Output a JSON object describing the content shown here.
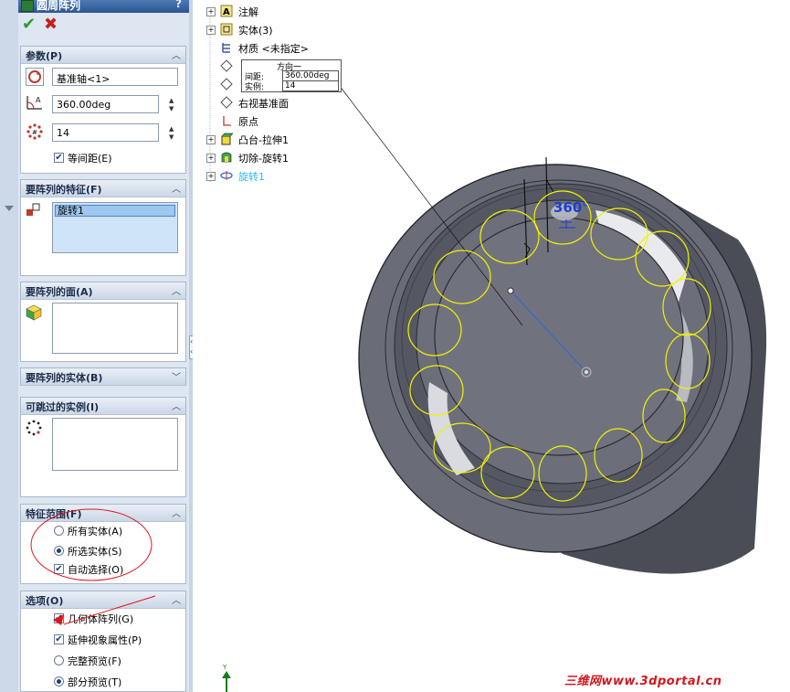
{
  "property_manager": {
    "title": "圆周阵列",
    "help": "?",
    "ok_icon": "checkmark-icon",
    "cancel_icon": "x-icon",
    "sections": {
      "params": {
        "label": "参数(P)",
        "axis_value": "基准轴<1>",
        "angle_value": "360.00deg",
        "instances_value": "14",
        "equal_spacing": "等间距(E)",
        "equal_spacing_checked": true
      },
      "features": {
        "label": "要阵列的特征(F)",
        "items": [
          "旋转1"
        ]
      },
      "faces": {
        "label": "要阵列的面(A)"
      },
      "bodies": {
        "label": "要阵列的实体(B)"
      },
      "skip": {
        "label": "可跳过的实例(I)"
      },
      "scope": {
        "label": "特征范围(F)",
        "all_bodies": "所有实体(A)",
        "selected_bodies": "所选实体(S)",
        "auto_select": "自动选择(O)",
        "selected": "selected_bodies",
        "auto_select_checked": true
      },
      "options": {
        "label": "选项(O)",
        "geometry_pattern": "几何体阵列(G)",
        "propagate": "延伸视象属性(P)",
        "full_preview": "完整预览(F)",
        "partial_preview": "部分预览(T)",
        "geometry_checked": true,
        "propagate_checked": true,
        "preview": "partial_preview"
      }
    }
  },
  "tree": {
    "items": [
      {
        "label": "注解",
        "icon": "annotation-icon",
        "expand": true
      },
      {
        "label": "实体(3)",
        "icon": "solid-bodies-icon",
        "expand": true
      },
      {
        "label": "材质 <未指定>",
        "icon": "material-icon",
        "expand": false
      },
      {
        "label": "",
        "icon": "plane-icon",
        "expand": false
      },
      {
        "label": "",
        "icon": "plane-icon",
        "expand": false
      },
      {
        "label": "右视基准面",
        "icon": "plane-icon",
        "expand": false
      },
      {
        "label": "原点",
        "icon": "origin-icon",
        "expand": false
      },
      {
        "label": "凸台-拉伸1",
        "icon": "extrude-icon",
        "expand": true
      },
      {
        "label": "切除-旋转1",
        "icon": "revolve-cut-icon",
        "expand": true
      },
      {
        "label": "旋转1",
        "icon": "revolve-icon",
        "expand": true,
        "highlight": true
      }
    ]
  },
  "callout": {
    "direction": "方向一",
    "spacing_label": "间距:",
    "spacing_value": "360.00deg",
    "instances_label": "实例:",
    "instances_value": "14"
  },
  "viewport": {
    "angle_label": "360°",
    "triad_label": "Y"
  },
  "watermark": "三维网www.3dportal.cn",
  "colors": {
    "preview_circles": "#f2f200",
    "body_gray": "#5e616c",
    "title_bar": "#2d5592",
    "watermark": "#d0181f"
  }
}
